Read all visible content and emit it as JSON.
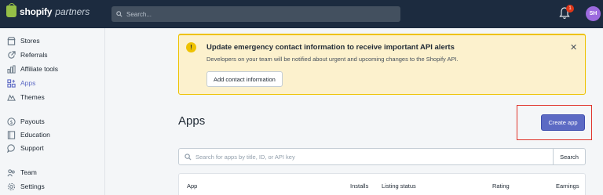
{
  "topbar": {
    "brand": "shopify",
    "brand_suffix": "partners",
    "search_placeholder": "Search...",
    "notification_count": "1",
    "avatar_initials": "SH"
  },
  "sidebar": {
    "items": [
      {
        "label": "Stores",
        "icon": "store-icon"
      },
      {
        "label": "Referrals",
        "icon": "referral-icon"
      },
      {
        "label": "Affiliate tools",
        "icon": "chart-icon"
      },
      {
        "label": "Apps",
        "icon": "apps-icon",
        "active": true
      },
      {
        "label": "Themes",
        "icon": "themes-icon"
      },
      {
        "label": "Payouts",
        "icon": "dollar-icon"
      },
      {
        "label": "Education",
        "icon": "book-icon"
      },
      {
        "label": "Support",
        "icon": "chat-icon"
      },
      {
        "label": "Team",
        "icon": "team-icon"
      },
      {
        "label": "Settings",
        "icon": "gear-icon"
      }
    ]
  },
  "banner": {
    "title": "Update emergency contact information to receive important API alerts",
    "description": "Developers on your team will be notified about urgent and upcoming changes to the Shopify API.",
    "button_label": "Add contact information"
  },
  "page": {
    "title": "Apps",
    "create_button": "Create app",
    "search_placeholder": "Search for apps by title, ID, or API key",
    "search_button": "Search"
  },
  "table": {
    "headers": [
      "App",
      "Installs",
      "Listing status",
      "Rating",
      "Earnings"
    ]
  },
  "colors": {
    "accent": "#5c6ac4",
    "topbar": "#1c2b3f",
    "banner_bg": "#fcf1cd",
    "highlight_border": "#e0332b"
  }
}
